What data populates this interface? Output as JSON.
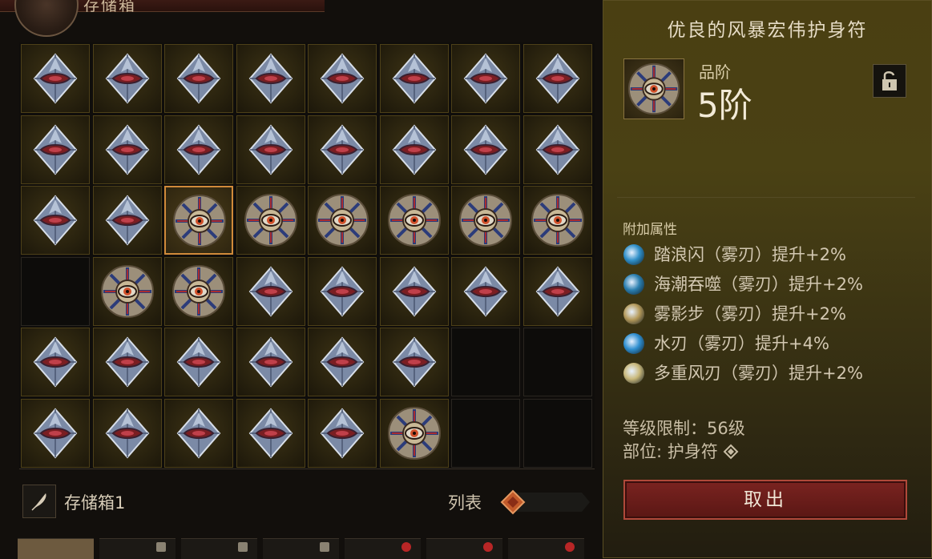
{
  "header": {
    "title": "存储箱"
  },
  "grid": {
    "rows": [
      [
        "amulet",
        "amulet",
        "amulet",
        "amulet",
        "amulet",
        "amulet",
        "amulet",
        "amulet"
      ],
      [
        "amulet",
        "amulet",
        "amulet",
        "amulet",
        "amulet",
        "amulet",
        "amulet",
        "amulet"
      ],
      [
        "amulet",
        "amulet",
        "storm-amulet-selected",
        "storm-amulet",
        "storm-amulet",
        "storm-amulet",
        "storm-amulet",
        "storm-amulet"
      ],
      [
        "empty",
        "storm-amulet",
        "storm-amulet",
        "amulet",
        "amulet",
        "amulet",
        "amulet",
        "amulet"
      ],
      [
        "amulet",
        "amulet",
        "amulet",
        "amulet",
        "amulet",
        "amulet",
        "empty",
        "empty"
      ],
      [
        "amulet",
        "amulet",
        "amulet",
        "amulet",
        "amulet",
        "storm-amulet",
        "empty",
        "empty"
      ]
    ]
  },
  "footer": {
    "box_label": "存储箱1",
    "list_label": "列表"
  },
  "tabs": [
    {
      "state": "active"
    },
    {
      "state": "normal"
    },
    {
      "state": "locked"
    },
    {
      "state": "locked"
    },
    {
      "state": "timed"
    },
    {
      "state": "timed"
    },
    {
      "state": "timed"
    }
  ],
  "detail": {
    "title": "优良的风暴宏伟护身符",
    "tier_label": "品阶",
    "tier_value": "5阶",
    "attr_heading": "附加属性",
    "attributes": [
      {
        "text": "踏浪闪（雾刃）提升+2%",
        "icon": "wave-dash-icon",
        "color": "#2f8fc8"
      },
      {
        "text": "海潮吞噬（雾刃）提升+2%",
        "icon": "tide-devour-icon",
        "color": "#2b7fb0"
      },
      {
        "text": "雾影步（雾刃）提升+2%",
        "icon": "mist-step-icon",
        "color": "#b59a5a"
      },
      {
        "text": "水刃（雾刃）提升+4%",
        "icon": "water-blade-icon",
        "color": "#2f8fd0"
      },
      {
        "text": "多重风刃（雾刃）提升+2%",
        "icon": "multi-wind-blade-icon",
        "color": "#c9b87a"
      }
    ],
    "level_req": "等级限制：56级",
    "slot_text": "部位: 护身符",
    "take_button": "取出"
  }
}
